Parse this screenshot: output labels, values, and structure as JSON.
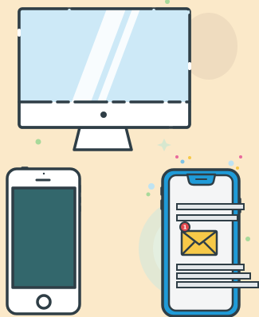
{
  "colors": {
    "background": "#fbe9c9",
    "outline": "#2f3e46",
    "monitor_screen": "#cde9f7",
    "monitor_bezel": "#ffffff",
    "phone_screen": "#33676c",
    "smartphone_frame": "#1f9bd8",
    "envelope": "#f7c948",
    "notification_badge": "#e0454b",
    "decor_blob": "#e9ddc4",
    "decor_circle": "#d8eadc",
    "decor_dot_green": "#a8d99a",
    "decor_dot_blue": "#7ec3e6",
    "decor_dot_pink": "#e96a9c"
  },
  "notification": {
    "count": "1"
  },
  "icons": [
    "desktop-monitor-icon",
    "classic-phone-icon",
    "smartphone-icon",
    "envelope-icon",
    "notification-badge-icon"
  ]
}
